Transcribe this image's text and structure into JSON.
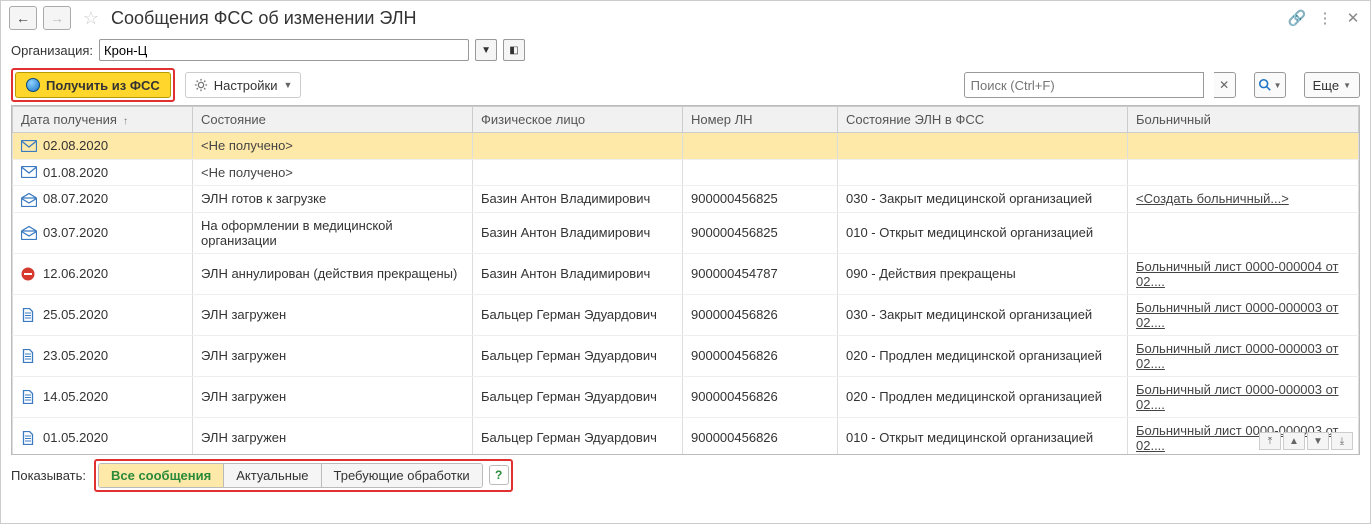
{
  "title": "Сообщения ФСС об изменении ЭЛН",
  "org_label": "Организация:",
  "org_value": "Крон-Ц",
  "toolbar": {
    "get_label": "Получить из ФСС",
    "settings_label": "Настройки",
    "search_placeholder": "Поиск (Ctrl+F)",
    "more_label": "Еще"
  },
  "columns": {
    "date": "Дата получения",
    "state": "Состояние",
    "person": "Физическое лицо",
    "num": "Номер ЛН",
    "fss": "Состояние ЭЛН в ФСС",
    "sick": "Больничный"
  },
  "rows": [
    {
      "icon": "env-closed",
      "date": "02.08.2020",
      "state": "<Не получено>",
      "person": "",
      "num": "",
      "fss": "",
      "sick": "",
      "link": false,
      "sel": true
    },
    {
      "icon": "env-closed",
      "date": "01.08.2020",
      "state": "<Не получено>",
      "person": "",
      "num": "",
      "fss": "",
      "sick": "",
      "link": false
    },
    {
      "icon": "env-open",
      "date": "08.07.2020",
      "state": "ЭЛН готов к загрузке",
      "person": "Базин Антон Владимирович",
      "num": "900000456825",
      "fss": "030 - Закрыт медицинской организацией",
      "sick": "<Создать больничный...>",
      "link": true
    },
    {
      "icon": "env-open",
      "date": "03.07.2020",
      "state": "На оформлении в медицинской организации",
      "person": "Базин Антон Владимирович",
      "num": "900000456825",
      "fss": "010 - Открыт медицинской организацией",
      "sick": "",
      "link": false
    },
    {
      "icon": "cancel",
      "date": "12.06.2020",
      "state": "ЭЛН аннулирован (действия прекращены)",
      "person": "Базин Антон Владимирович",
      "num": "900000454787",
      "fss": "090 - Действия прекращены",
      "sick": "Больничный лист 0000-000004 от 02....",
      "link": true
    },
    {
      "icon": "doc",
      "date": "25.05.2020",
      "state": "ЭЛН загружен",
      "person": "Бальцер Герман Эдуардович",
      "num": "900000456826",
      "fss": "030 - Закрыт медицинской организацией",
      "sick": "Больничный лист 0000-000003 от 02....",
      "link": true
    },
    {
      "icon": "doc",
      "date": "23.05.2020",
      "state": "ЭЛН загружен",
      "person": "Бальцер Герман Эдуардович",
      "num": "900000456826",
      "fss": "020 - Продлен медицинской организацией",
      "sick": "Больничный лист 0000-000003 от 02....",
      "link": true
    },
    {
      "icon": "doc",
      "date": "14.05.2020",
      "state": "ЭЛН загружен",
      "person": "Бальцер Герман Эдуардович",
      "num": "900000456826",
      "fss": "020 - Продлен медицинской организацией",
      "sick": "Больничный лист 0000-000003 от 02....",
      "link": true
    },
    {
      "icon": "doc",
      "date": "01.05.2020",
      "state": "ЭЛН загружен",
      "person": "Бальцер Герман Эдуардович",
      "num": "900000456826",
      "fss": "010 - Открыт медицинской организацией",
      "sick": "Больничный лист 0000-000003 от 02....",
      "link": true
    }
  ],
  "footer": {
    "label": "Показывать:",
    "tab_all": "Все сообщения",
    "tab_actual": "Актуальные",
    "tab_need": "Требующие обработки",
    "help": "?"
  }
}
